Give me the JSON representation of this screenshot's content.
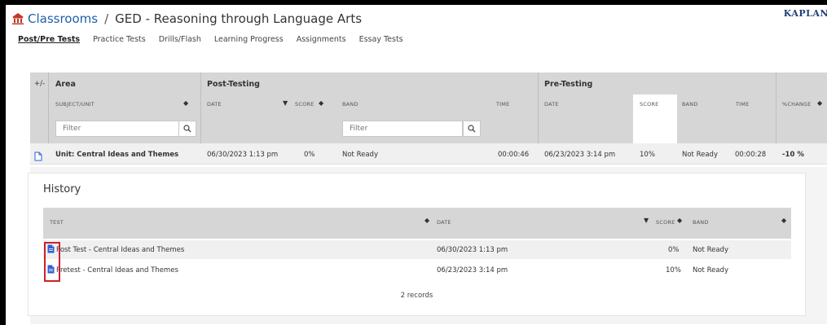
{
  "header": {
    "breadcrumb_root": "Classrooms",
    "breadcrumb_sep": "/",
    "breadcrumb_current": "GED - Reasoning through Language Arts",
    "brand": "KAPLAN"
  },
  "nav_tabs": [
    {
      "label": "Post/Pre Tests",
      "active": true
    },
    {
      "label": "Practice Tests",
      "active": false
    },
    {
      "label": "Drills/Flash",
      "active": false
    },
    {
      "label": "Learning Progress",
      "active": false
    },
    {
      "label": "Assignments",
      "active": false
    },
    {
      "label": "Essay Tests",
      "active": false
    }
  ],
  "table": {
    "expand_header": "+/-",
    "area_header": "Area",
    "post_testing_header": "Post-Testing",
    "pre_testing_header": "Pre-Testing",
    "sub_headers": {
      "subject_unit": "SUBJECT/UNIT",
      "post_date": "DATE",
      "post_score": "SCORE",
      "post_band": "BAND",
      "post_time": "TIME",
      "pre_date": "DATE",
      "pre_score": "SCORE",
      "pre_band": "BAND",
      "pre_time": "TIME",
      "change": "%CHANGE"
    },
    "filter_placeholder": "Filter",
    "row": {
      "unit": "Unit: Central Ideas and Themes",
      "post_date": "06/30/2023 1:13 pm",
      "post_score": "0%",
      "post_band": "Not Ready",
      "post_time": "00:00:46",
      "pre_date": "06/23/2023 3:14 pm",
      "pre_score": "10%",
      "pre_band": "Not Ready",
      "pre_time": "00:00:28",
      "change": "-10 %"
    }
  },
  "history": {
    "title": "History",
    "headers": {
      "test": "TEST",
      "date": "DATE",
      "score": "SCORE",
      "band": "BAND"
    },
    "rows": [
      {
        "test": "Post Test - Central Ideas and Themes",
        "date": "06/30/2023 1:13 pm",
        "score": "0%",
        "band": "Not Ready"
      },
      {
        "test": "Pretest - Central Ideas and Themes",
        "date": "06/23/2023 3:14 pm",
        "score": "10%",
        "band": "Not Ready"
      }
    ],
    "records": "2 records"
  },
  "colors": {
    "link": "#1f5fa8",
    "header_band": "#d6d6d6",
    "highlight": "#d0202a",
    "icon_blue": "#2f5fd0",
    "brand_red": "#c0392b"
  }
}
